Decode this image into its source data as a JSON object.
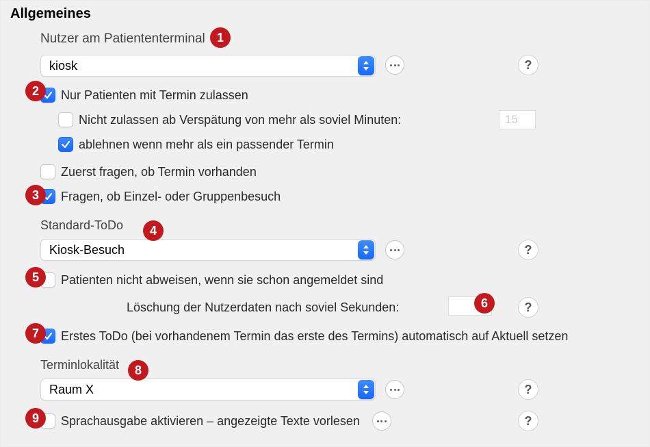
{
  "section_title": "Allgemeines",
  "user_label": "Nutzer am Patiententerminal",
  "user_value": "kiosk",
  "cb_only_with_appt": "Nur Patienten mit Termin zulassen",
  "cb_late_deny": "Nicht zulassen ab Verspätung von mehr als soviel Minuten:",
  "late_deny_minutes": "15",
  "cb_reject_multi": "ablehnen wenn mehr als ein passender Termin",
  "cb_ask_first": "Zuerst fragen, ob Termin vorhanden",
  "cb_ask_group": "Fragen, ob Einzel- oder Gruppenbesuch",
  "todo_label": "Standard-ToDo",
  "todo_value": "Kiosk-Besuch",
  "cb_no_reject_registered": "Patienten nicht abweisen, wenn sie schon angemeldet sind",
  "delete_userdata_label": "Löschung der Nutzerdaten nach soviel Sekunden:",
  "cb_first_todo_auto": "Erstes ToDo (bei vorhandenem Termin das erste des Termins) automatisch auf Aktuell setzen",
  "locality_label": "Terminlokalität",
  "locality_value": "Raum X",
  "cb_speech": "Sprachausgabe aktivieren – angezeigte Texte vorlesen",
  "help_glyph": "?",
  "markers": {
    "m1": "1",
    "m2": "2",
    "m3": "3",
    "m4": "4",
    "m5": "5",
    "m6": "6",
    "m7": "7",
    "m8": "8",
    "m9": "9"
  }
}
